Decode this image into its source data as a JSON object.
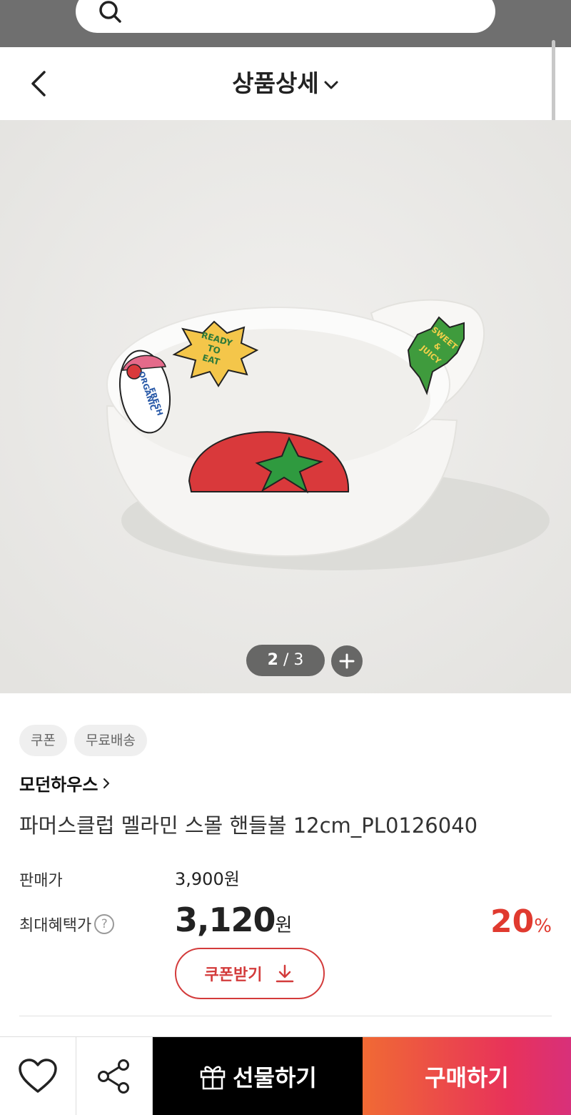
{
  "header": {
    "title": "상품상세"
  },
  "gallery": {
    "current_page": "2",
    "separator": "/",
    "total_pages": "3",
    "bowl_texts": {
      "left_badge_line1": "ORGANIC",
      "left_badge_line2": "FRESH",
      "center_badge_line1": "READY",
      "center_badge_line2": "TO",
      "center_badge_line3": "EAT",
      "right_badge_line1": "SWEET",
      "right_badge_line2": "&",
      "right_badge_line3": "JUICY"
    }
  },
  "product": {
    "tags": [
      "쿠폰",
      "무료배송"
    ],
    "brand": "모던하우스",
    "name": "파머스클럽 멜라민 스몰 핸들볼 12cm_PL0126040",
    "sale_price_label": "판매가",
    "sale_price": "3,900원",
    "max_benefit_label": "최대혜택가",
    "max_benefit_help": "?",
    "max_benefit_price": "3,120",
    "currency_unit": "원",
    "discount_rate": "20",
    "discount_unit": "%",
    "coupon_button": "쿠폰받기"
  },
  "bottom_bar": {
    "gift_label": "선물하기",
    "buy_label": "구매하기"
  },
  "colors": {
    "accent_red": "#e03a2f",
    "buy_gradient_start": "#f06a34",
    "buy_gradient_end": "#d8307a"
  }
}
